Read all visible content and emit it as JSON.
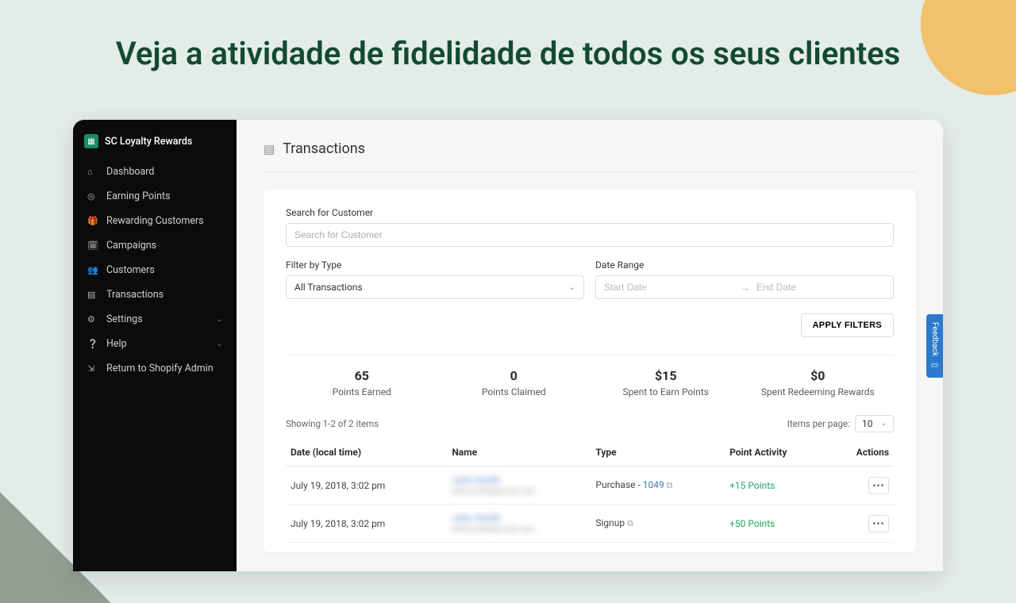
{
  "hero": "Veja a atividade de fidelidade de todos os seus clientes",
  "brand": {
    "name": "SC Loyalty Rewards"
  },
  "nav": [
    {
      "label": "Dashboard",
      "icon": "⌂"
    },
    {
      "label": "Earning Points",
      "icon": "◎"
    },
    {
      "label": "Rewarding Customers",
      "icon": "🎁"
    },
    {
      "label": "Campaigns",
      "icon": "🗓"
    },
    {
      "label": "Customers",
      "icon": "👥"
    },
    {
      "label": "Transactions",
      "icon": "▤"
    },
    {
      "label": "Settings",
      "icon": "⚙",
      "chev": true
    },
    {
      "label": "Help",
      "icon": "❔",
      "chev": true
    },
    {
      "label": "Return to Shopify Admin",
      "icon": "⇲"
    }
  ],
  "page": {
    "title": "Transactions"
  },
  "filters": {
    "search_label": "Search for Customer",
    "search_placeholder": "Search for Customer",
    "type_label": "Filter by Type",
    "type_value": "All Transactions",
    "range_label": "Date Range",
    "start_placeholder": "Start Date",
    "end_placeholder": "End Date",
    "apply_label": "APPLY FILTERS"
  },
  "stats": [
    {
      "value": "65",
      "label": "Points Earned"
    },
    {
      "value": "0",
      "label": "Points Claimed"
    },
    {
      "value": "$15",
      "label": "Spent to Earn Points"
    },
    {
      "value": "$0",
      "label": "Spent Redeeming Rewards"
    }
  ],
  "pager": {
    "showing": "Showing 1-2 of 2 items",
    "ipp_label": "Items per page:",
    "ipp_value": "10"
  },
  "columns": {
    "date": "Date (local time)",
    "name": "Name",
    "type": "Type",
    "activity": "Point Activity",
    "actions": "Actions"
  },
  "rows": [
    {
      "date": "July 19, 2018, 3:02 pm",
      "name": "John Smith",
      "email": "johnsmith@email.com",
      "type_pre": "Purchase - ",
      "type_link": "1049",
      "activity": "+15 Points"
    },
    {
      "date": "July 19, 2018, 3:02 pm",
      "name": "John Smith",
      "email": "johnsmith@email.com",
      "type_pre": "Signup ",
      "type_link": "",
      "activity": "+50 Points"
    }
  ],
  "feedback": {
    "label": "Feedback"
  }
}
